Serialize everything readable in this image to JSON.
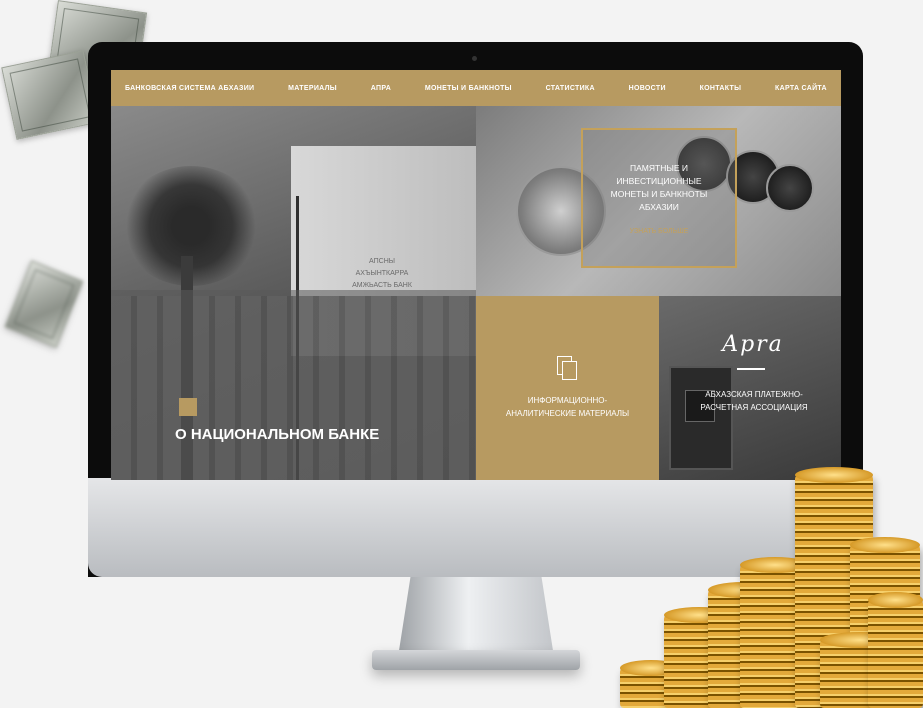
{
  "nav": {
    "items": [
      {
        "label": "БАНКОВСКАЯ СИСТЕМА АБХАЗИИ"
      },
      {
        "label": "МАТЕРИАЛЫ"
      },
      {
        "label": "АПРА"
      },
      {
        "label": "МОНЕТЫ И БАНКНОТЫ"
      },
      {
        "label": "СТАТИСТИКА"
      },
      {
        "label": "НОВОСТИ"
      },
      {
        "label": "КОНТАКТЫ"
      },
      {
        "label": "КАРТА САЙТА"
      }
    ]
  },
  "tiles": {
    "bank": {
      "title": "О НАЦИОНАЛЬНОМ БАНКЕ",
      "facade": "АПСНЫ АХЪЫНТКАРРА АМЖЬАСТЬ БАНК"
    },
    "coins": {
      "title": "ПАМЯТНЫЕ И ИНВЕСТИЦИОННЫЕ МОНЕТЫ И БАНКНОТЫ АБХАЗИИ",
      "link": "УЗНАТЬ БОЛЬШЕ"
    },
    "materials": {
      "title": "ИНФОРМАЦИОННО-АНАЛИТИЧЕСКИЕ МАТЕРИАЛЫ",
      "icon": "document-icon"
    },
    "apra": {
      "logo": "Apra",
      "title": "АБХАЗСКАЯ ПЛАТЕЖНО-РАСЧЕТНАЯ АССОЦИАЦИЯ"
    }
  },
  "colors": {
    "accent_gold": "#b79a61",
    "frame_gold": "#c4a15a"
  }
}
